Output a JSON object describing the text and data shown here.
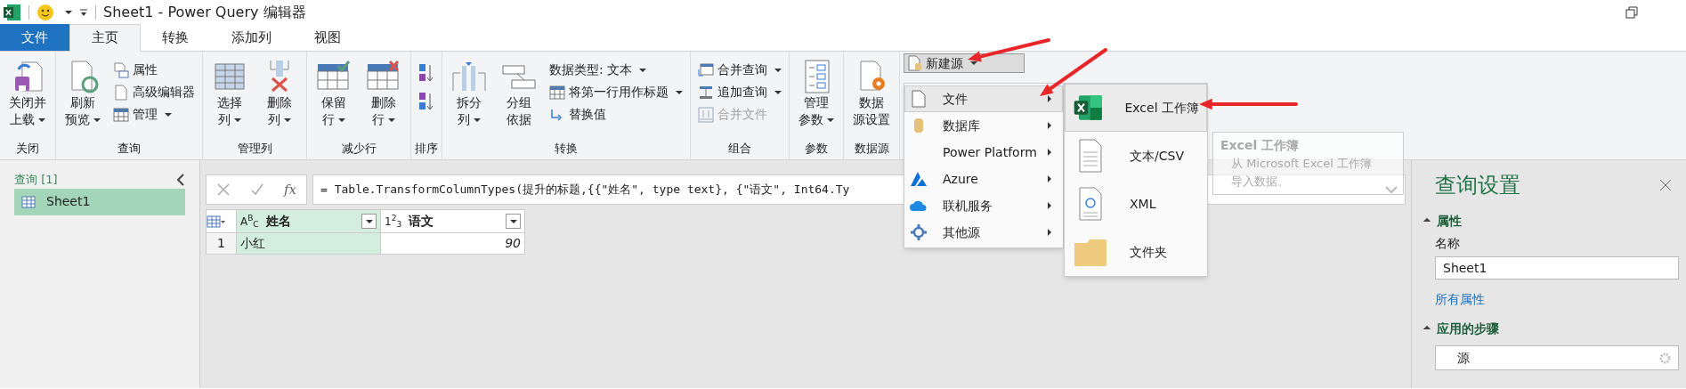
{
  "title_bar": {
    "title": "Sheet1 - Power Query 编辑器"
  },
  "tabs": [
    {
      "label": "文件",
      "kind": "file",
      "selected": false
    },
    {
      "label": "主页",
      "kind": "tab",
      "selected": true
    },
    {
      "label": "转换",
      "kind": "tab",
      "selected": false
    },
    {
      "label": "添加列",
      "kind": "tab",
      "selected": false
    },
    {
      "label": "视图",
      "kind": "tab",
      "selected": false
    }
  ],
  "ribbon_groups": [
    {
      "label": "关闭",
      "columns": [
        {
          "kind": "large",
          "lines": [
            "关闭并",
            "上载"
          ],
          "dropdown": true
        }
      ]
    },
    {
      "label": "查询",
      "columns": [
        {
          "kind": "large",
          "lines": [
            "刷新",
            "预览"
          ],
          "dropdown": true
        },
        {
          "kind": "stack",
          "items": [
            {
              "label": "属性",
              "dropdown": false,
              "disabled": false
            },
            {
              "label": "高级编辑器",
              "dropdown": false,
              "disabled": false
            },
            {
              "label": "管理",
              "dropdown": true,
              "disabled": false
            }
          ]
        }
      ]
    },
    {
      "label": "管理列",
      "columns": [
        {
          "kind": "large",
          "lines": [
            "选择",
            "列"
          ],
          "dropdown": true
        },
        {
          "kind": "large",
          "lines": [
            "删除",
            "列"
          ],
          "dropdown": true
        }
      ]
    },
    {
      "label": "减少行",
      "columns": [
        {
          "kind": "large",
          "lines": [
            "保留",
            "行"
          ],
          "dropdown": true
        },
        {
          "kind": "large",
          "lines": [
            "删除",
            "行"
          ],
          "dropdown": true
        }
      ]
    },
    {
      "label": "排序",
      "columns": [
        {
          "kind": "iconstack",
          "items": [
            {
              "kind": "ascending"
            },
            {
              "kind": "descending"
            }
          ]
        }
      ]
    },
    {
      "label": "转换",
      "columns": [
        {
          "kind": "large",
          "lines": [
            "拆分",
            "列"
          ],
          "dropdown": true
        },
        {
          "kind": "large",
          "lines": [
            "分组",
            "依据"
          ],
          "dropdown": false
        },
        {
          "kind": "stack",
          "items": [
            {
              "label": "数据类型: 文本",
              "dropdown": true,
              "disabled": false
            },
            {
              "label": "将第一行用作标题",
              "dropdown": true,
              "disabled": false
            },
            {
              "label": "替换值",
              "dropdown": false,
              "disabled": false
            }
          ]
        }
      ]
    },
    {
      "label": "组合",
      "columns": [
        {
          "kind": "stack",
          "items": [
            {
              "label": "合并查询",
              "dropdown": true,
              "disabled": false
            },
            {
              "label": "追加查询",
              "dropdown": true,
              "disabled": false
            },
            {
              "label": "合并文件",
              "dropdown": false,
              "disabled": true
            }
          ]
        }
      ]
    },
    {
      "label": "参数",
      "columns": [
        {
          "kind": "large",
          "lines": [
            "管理",
            "参数"
          ],
          "dropdown": true
        }
      ]
    },
    {
      "label": "数据源",
      "columns": [
        {
          "kind": "large",
          "lines": [
            "数据",
            "源设置"
          ],
          "dropdown": false
        }
      ]
    }
  ],
  "new_source": {
    "label": "新建源",
    "dropdown": true,
    "pressed": true
  },
  "source_menu": [
    {
      "label": "文件",
      "selected": true
    },
    {
      "label": "数据库",
      "selected": false
    },
    {
      "label": "Power Platform",
      "selected": false
    },
    {
      "label": "Azure",
      "selected": false
    },
    {
      "label": "联机服务",
      "selected": false
    },
    {
      "label": "其他源",
      "selected": false
    }
  ],
  "file_submenu": [
    {
      "label": "Excel 工作簿",
      "selected": true
    },
    {
      "label": "文本/CSV",
      "selected": false
    },
    {
      "label": "XML",
      "selected": false
    },
    {
      "label": "文件夹",
      "selected": false
    }
  ],
  "tooltip": {
    "title": "Excel 工作簿",
    "text": "从 Microsoft Excel 工作簿导入数据。"
  },
  "queries_pane": {
    "heading": "查询 [1]",
    "items": [
      {
        "label": "Sheet1",
        "selected": true
      }
    ]
  },
  "formula_bar": {
    "fx": "fx",
    "formula": "= Table.TransformColumnTypes(提升的标题,{{\"姓名\", type text}, {\"语文\", Int64.Ty"
  },
  "table": {
    "columns": [
      {
        "type": "A$^{B}$$_{C}$",
        "name": "姓名",
        "selected": true
      },
      {
        "type": "1$^{2}$$_{3}$",
        "name": "语文",
        "selected": false
      }
    ],
    "rows": [
      {
        "index": "1",
        "cells": [
          "小红",
          "90"
        ]
      }
    ]
  },
  "settings_pane": {
    "title": "查询设置",
    "sections": [
      {
        "kind": "properties",
        "title": "属性",
        "expanded": true,
        "name_label": "名称",
        "name_value": "Sheet1",
        "link": "所有属性"
      },
      {
        "kind": "steps",
        "title": "应用的步骤",
        "expanded": true,
        "steps": [
          {
            "label": "源",
            "selected": false
          }
        ]
      }
    ]
  }
}
